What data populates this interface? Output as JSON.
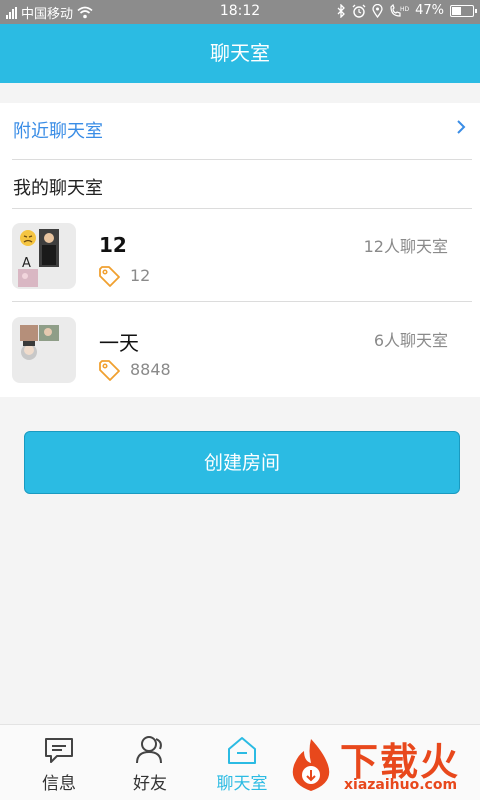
{
  "status_bar": {
    "carrier": "中国移动",
    "time": "18:12",
    "battery": "47%",
    "battery_level": 0.47,
    "icons": [
      "signal-icon",
      "wifi-icon",
      "bluetooth-icon",
      "alarm-icon",
      "location-icon",
      "hd-call-icon",
      "battery-icon"
    ]
  },
  "header": {
    "title": "聊天室"
  },
  "nearby": {
    "label": "附近聊天室"
  },
  "my_rooms": {
    "heading": "我的聊天室",
    "rooms": [
      {
        "name": "12",
        "member_count": "12人聊天室",
        "tag": "12"
      },
      {
        "name": "一天",
        "member_count": "6人聊天室",
        "tag": "8848"
      }
    ]
  },
  "create_button": {
    "label": "创建房间"
  },
  "bottom_nav": {
    "items": [
      {
        "label": "信息",
        "icon": "message-icon"
      },
      {
        "label": "好友",
        "icon": "friends-icon"
      },
      {
        "label": "聊天室",
        "icon": "chatroom-icon"
      }
    ],
    "active": "聊天室"
  },
  "watermark": {
    "text": "下载火",
    "url_text": "xiazaihuo.com"
  },
  "colors": {
    "accent": "#2bbbe3",
    "link": "#3a8de6",
    "tag": "#f0a030",
    "watermark": "#e8481c"
  }
}
